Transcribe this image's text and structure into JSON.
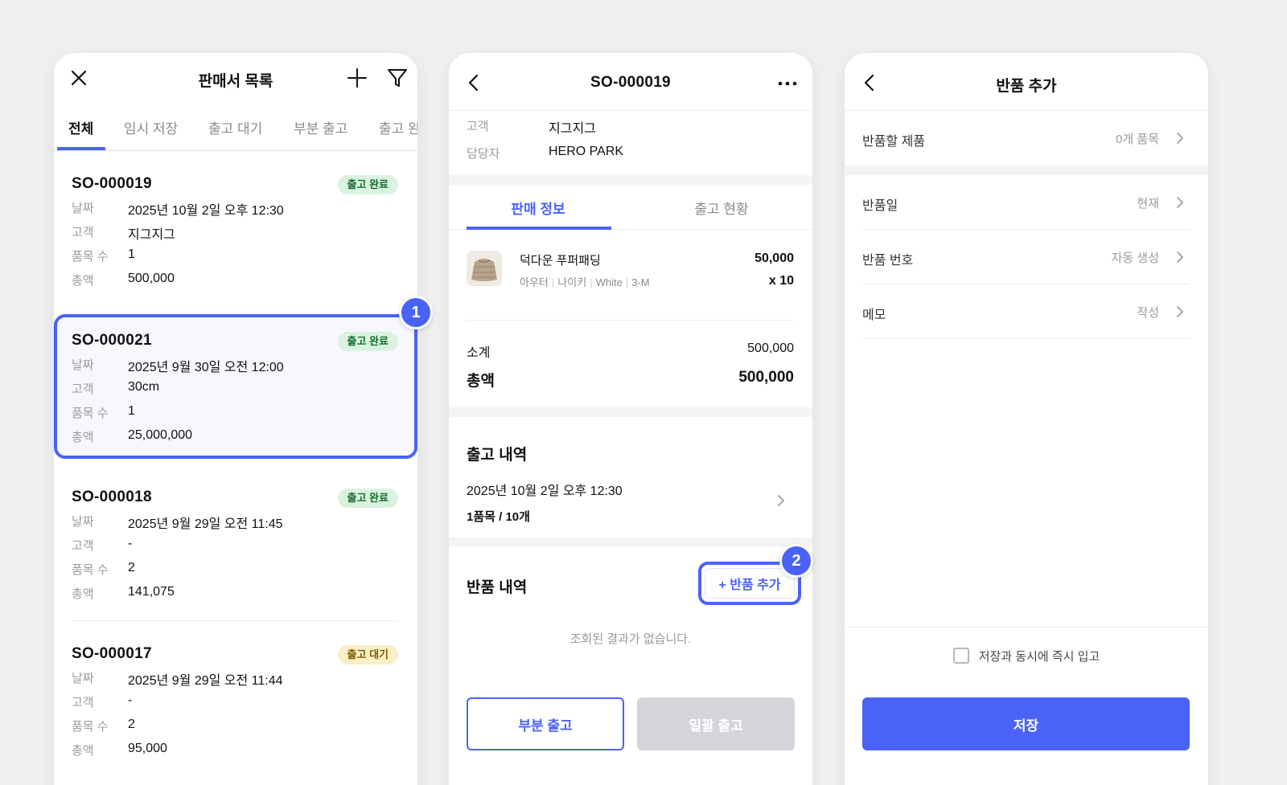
{
  "accent_color": "#4a63f6",
  "list_screen": {
    "title": "판매서 목록",
    "close_icon": "close-icon",
    "add_icon": "plus-icon",
    "filter_icon": "filter-icon",
    "tabs": [
      {
        "label": "전체",
        "active": true
      },
      {
        "label": "임시 저장",
        "active": false
      },
      {
        "label": "출고 대기",
        "active": false
      },
      {
        "label": "부분 출고",
        "active": false
      },
      {
        "label": "출고 완",
        "active": false
      }
    ],
    "field_labels": {
      "date": "날짜",
      "customer": "고객",
      "item_count": "품목 수",
      "total": "총액"
    },
    "orders": [
      {
        "no": "SO-000019",
        "status": "출고 완료",
        "date": "2025년 10월 2일 오후 12:30",
        "customer": "지그지그",
        "item_count": "1",
        "total": "500,000"
      },
      {
        "no": "SO-000021",
        "status": "출고 완료",
        "date": "2025년 9월 30일 오전 12:00",
        "customer": "30cm",
        "item_count": "1",
        "total": "25,000,000"
      },
      {
        "no": "SO-000018",
        "status": "출고 완료",
        "date": "2025년 9월 29일 오전 11:45",
        "customer": "-",
        "item_count": "2",
        "total": "141,075"
      },
      {
        "no": "SO-000017",
        "status": "출고 대기",
        "date": "2025년 9월 29일 오전 11:44",
        "customer": "-",
        "item_count": "2",
        "total": "95,000"
      }
    ],
    "step_badge": "1"
  },
  "detail_screen": {
    "title": "SO-000019",
    "back_icon": "chevron-left-icon",
    "more_icon": "more-icon",
    "customer_label": "고객",
    "customer_value": "지그지그",
    "manager_label": "담당자",
    "manager_value": "HERO PARK",
    "tabs": [
      {
        "label": "판매 정보",
        "active": true
      },
      {
        "label": "출고 현황",
        "active": false
      }
    ],
    "product": {
      "name": "덕다운 푸퍼패딩",
      "options": [
        "아우터",
        "나이키",
        "White",
        "3-M"
      ],
      "price": "50,000",
      "qty": "x 10"
    },
    "subtotal_label": "소계",
    "subtotal_value": "500,000",
    "total_label": "총액",
    "total_value": "500,000",
    "shipping_title": "출고 내역",
    "shipping_date": "2025년 10월 2일 오후 12:30",
    "shipping_count": "1품목 / 10개",
    "return_title": "반품 내역",
    "return_add_label": "+ 반품 추가",
    "return_empty": "조회된 결과가 없습니다.",
    "partial_ship_label": "부분 출고",
    "bulk_ship_label": "일괄 출고",
    "step_badge": "2"
  },
  "return_screen": {
    "title": "반품 추가",
    "back_icon": "chevron-left-icon",
    "rows": [
      {
        "label": "반품할 제품",
        "value": "0개 품목"
      },
      {
        "label": "반품일",
        "value": "현재"
      },
      {
        "label": "반품 번호",
        "value": "자동 생성"
      },
      {
        "label": "메모",
        "value": "작성"
      }
    ],
    "checkbox_label": "저장과 동시에 즉시 입고",
    "checkbox_checked": false,
    "save_label": "저장"
  }
}
